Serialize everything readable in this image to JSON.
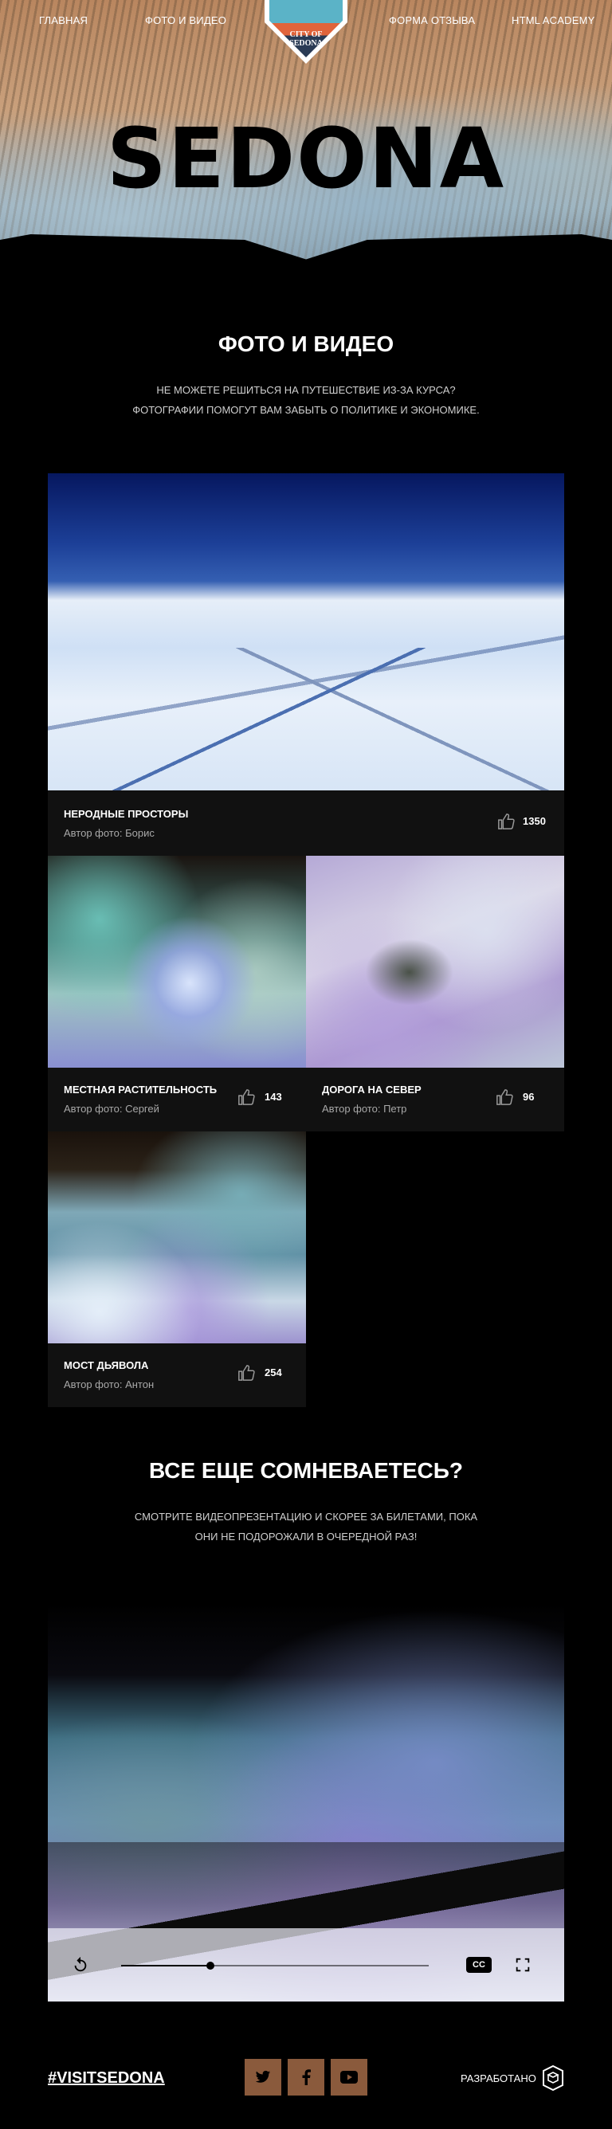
{
  "header": {
    "nav": [
      {
        "label": "ГЛАВНАЯ"
      },
      {
        "label": "ФОТО И ВИДЕО"
      },
      {
        "label": "ФОРМА ОТЗЫВА"
      },
      {
        "label": "HTML ACADEMY"
      }
    ],
    "logo_text": "CITY OF SEDONA",
    "title": "SEDONA"
  },
  "intro": {
    "heading": "ФОТО И ВИДЕО",
    "line1": "НЕ МОЖЕТЕ РЕШИТЬСЯ НА ПУТЕШЕСТВИЕ ИЗ-ЗА КУРСА?",
    "line2": "ФОТОГРАФИИ ПОМОГУТ ВАМ ЗАБЫТЬ О ПОЛИТИКЕ И ЭКОНОМИКЕ."
  },
  "gallery": [
    {
      "title": "НЕРОДНЫЕ ПРОСТОРЫ",
      "author": "Автор фото: Борис",
      "likes": "1350"
    },
    {
      "title": "МЕСТНАЯ РАСТИТЕЛЬНОСТЬ",
      "author": "Автор фото: Сергей",
      "likes": "143"
    },
    {
      "title": "ДОРОГА НА СЕВЕР",
      "author": "Автор фото: Петр",
      "likes": "96"
    },
    {
      "title": "МОСТ ДЬЯВОЛА",
      "author": "Автор фото: Антон",
      "likes": "254"
    }
  ],
  "doubt": {
    "heading": "ВСЕ ЕЩЕ СОМНЕВАЕТЕСЬ?",
    "line1": "СМОТРИТЕ ВИДЕОПРЕЗЕНТАЦИЮ И СКОРЕЕ ЗА БИЛЕТАМИ, ПОКА",
    "line2": "ОНИ НЕ ПОДОРОЖАЛИ В ОЧЕРЕДНОЙ РАЗ!"
  },
  "video": {
    "progress": 0.29,
    "cc_label": "CC",
    "icons": [
      "replay-icon",
      "fullscreen-icon"
    ]
  },
  "footer": {
    "hashtag": "#VISITSEDONA",
    "social": [
      "twitter-icon",
      "facebook-icon",
      "youtube-icon"
    ],
    "developed_by": "РАЗРАБОТАНО",
    "accent": "#8a5a3c"
  }
}
